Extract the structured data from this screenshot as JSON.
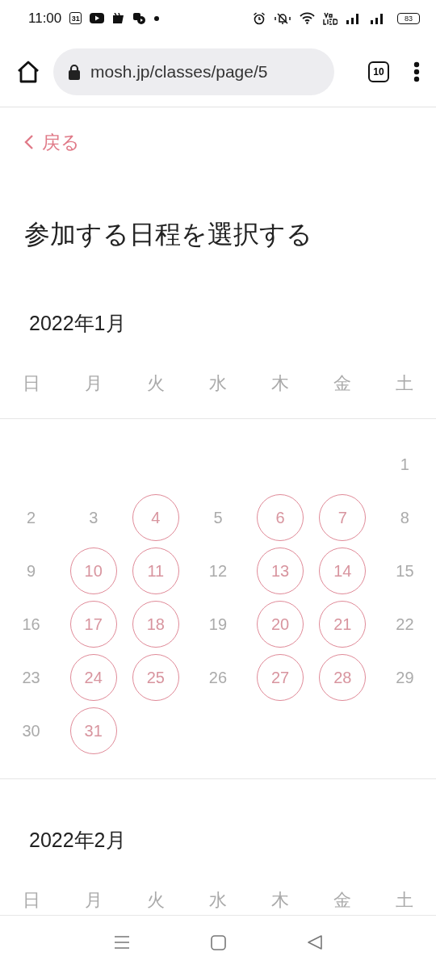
{
  "status_bar": {
    "time": "11:00",
    "calendar_day": "31",
    "battery": "83"
  },
  "browser": {
    "url": "mosh.jp/classes/page/5",
    "tab_count": "10"
  },
  "back_link": {
    "label": "戻る"
  },
  "title": "参加する日程を選択する",
  "months": [
    {
      "label": "2022年1月",
      "weekdays": [
        "日",
        "月",
        "火",
        "水",
        "木",
        "金",
        "土"
      ],
      "weeks": [
        [
          {
            "label": "1",
            "available": false
          }
        ],
        [
          {
            "label": "2",
            "available": false
          },
          {
            "label": "3",
            "available": false
          },
          {
            "label": "4",
            "available": true
          },
          {
            "label": "5",
            "available": false
          },
          {
            "label": "6",
            "available": true
          },
          {
            "label": "7",
            "available": true
          },
          {
            "label": "8",
            "available": false
          }
        ],
        [
          {
            "label": "9",
            "available": false
          },
          {
            "label": "10",
            "available": true
          },
          {
            "label": "11",
            "available": true
          },
          {
            "label": "12",
            "available": false
          },
          {
            "label": "13",
            "available": true
          },
          {
            "label": "14",
            "available": true
          },
          {
            "label": "15",
            "available": false
          }
        ],
        [
          {
            "label": "16",
            "available": false
          },
          {
            "label": "17",
            "available": true
          },
          {
            "label": "18",
            "available": true
          },
          {
            "label": "19",
            "available": false
          },
          {
            "label": "20",
            "available": true
          },
          {
            "label": "21",
            "available": true
          },
          {
            "label": "22",
            "available": false
          }
        ],
        [
          {
            "label": "23",
            "available": false
          },
          {
            "label": "24",
            "available": true
          },
          {
            "label": "25",
            "available": true
          },
          {
            "label": "26",
            "available": false
          },
          {
            "label": "27",
            "available": true
          },
          {
            "label": "28",
            "available": true
          },
          {
            "label": "29",
            "available": false
          }
        ],
        [
          {
            "label": "30",
            "available": false
          },
          {
            "label": "31",
            "available": true
          }
        ]
      ]
    },
    {
      "label": "2022年2月",
      "weekdays": [
        "日",
        "月",
        "火",
        "水",
        "木",
        "金",
        "土"
      ]
    }
  ]
}
